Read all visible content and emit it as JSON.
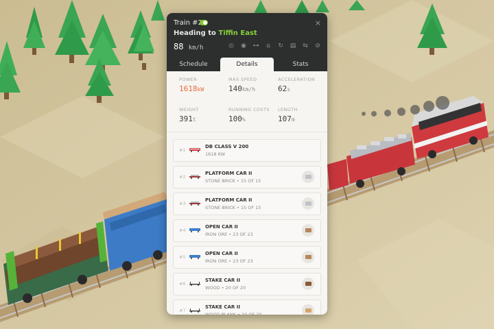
{
  "train": {
    "title": "Train #2",
    "heading_prefix": "Heading to",
    "destination": "Tiffin East",
    "speed": "88",
    "speed_unit": "km/h",
    "close": "×"
  },
  "header_icons": [
    "target-icon",
    "eye-icon",
    "route-icon",
    "depot-icon",
    "refresh-icon",
    "document-icon",
    "reverse-icon",
    "mute-icon"
  ],
  "tabs": [
    {
      "label": "Schedule"
    },
    {
      "label": "Details",
      "active": true
    },
    {
      "label": "Stats"
    }
  ],
  "stats": [
    {
      "label": "POWER",
      "value": "1618",
      "unit": "kW"
    },
    {
      "label": "MAX SPEED",
      "value": "140",
      "unit": "km/h"
    },
    {
      "label": "ACCELERATION",
      "value": "62",
      "unit": "s"
    },
    {
      "label": "WEIGHT",
      "value": "391",
      "unit": "t"
    },
    {
      "label": "RUNNING COSTS",
      "value": "100",
      "unit": "%"
    },
    {
      "label": "LENGTH",
      "value": "107",
      "unit": "m"
    }
  ],
  "cars": [
    {
      "num": "#1",
      "name": "DB CLASS V 200",
      "sub": "1618 KW",
      "type": "loco",
      "color": "#c8363c"
    },
    {
      "num": "#2",
      "name": "PLATFORM CAR II",
      "sub": "STONE BRICK • 15 OF 15",
      "type": "platform",
      "color": "#9b3b3b",
      "cargo_color": "#bfc2c6"
    },
    {
      "num": "#3",
      "name": "PLATFORM CAR II",
      "sub": "STONE BRICK • 15 OF 15",
      "type": "platform",
      "color": "#9b3b3b",
      "cargo_color": "#bfc2c6"
    },
    {
      "num": "#4",
      "name": "OPEN CAR II",
      "sub": "IRON ORE • 23 OF 23",
      "type": "open",
      "color": "#3f7fc8",
      "cargo_color": "#b7865a"
    },
    {
      "num": "#5",
      "name": "OPEN CAR II",
      "sub": "IRON ORE • 23 OF 23",
      "type": "open",
      "color": "#3f7fc8",
      "cargo_color": "#b7865a"
    },
    {
      "num": "#6",
      "name": "STAKE CAR II",
      "sub": "WOOD • 20 OF 20",
      "type": "stake",
      "color": "#444",
      "cargo_color": "#8a5a34"
    },
    {
      "num": "#7",
      "name": "STAKE CAR II",
      "sub": "WOOD PLANK • 20 OF 20",
      "type": "stake",
      "color": "#444",
      "cargo_color": "#d4a66a"
    }
  ],
  "colors": {
    "accent_green": "#8ad13b",
    "power_orange": "#ea6a3b",
    "header": "#2c2f2e"
  }
}
